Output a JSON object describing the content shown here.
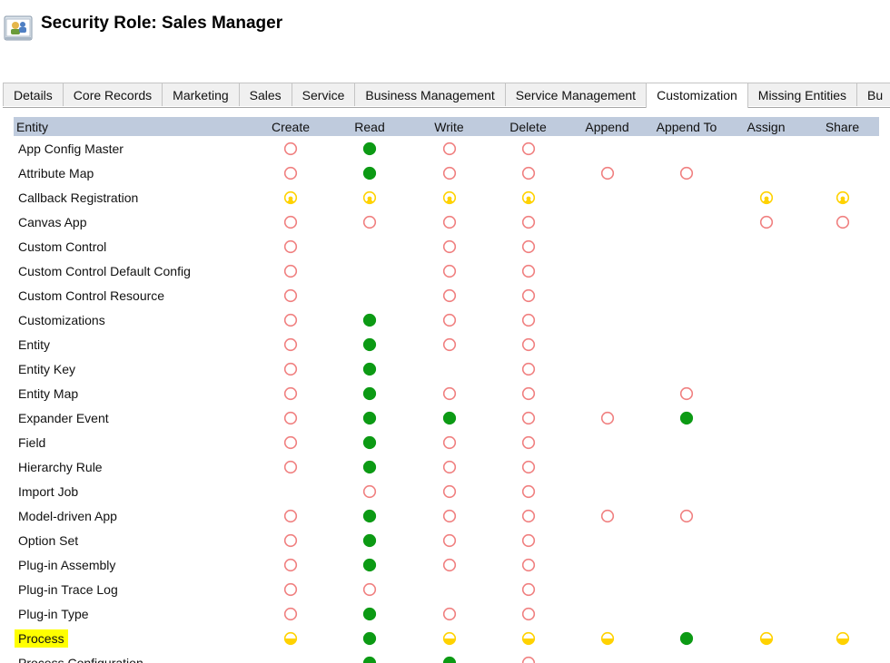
{
  "header": {
    "title": "Security Role: Sales Manager",
    "icon": "security-role-icon"
  },
  "tabs": [
    {
      "label": "Details",
      "active": false
    },
    {
      "label": "Core Records",
      "active": false
    },
    {
      "label": "Marketing",
      "active": false
    },
    {
      "label": "Sales",
      "active": false
    },
    {
      "label": "Service",
      "active": false
    },
    {
      "label": "Business Management",
      "active": false
    },
    {
      "label": "Service Management",
      "active": false
    },
    {
      "label": "Customization",
      "active": true
    },
    {
      "label": "Missing Entities",
      "active": false
    },
    {
      "label": "Bu",
      "active": false
    }
  ],
  "columns": [
    "Entity",
    "Create",
    "Read",
    "Write",
    "Delete",
    "Append",
    "Append To",
    "Assign",
    "Share"
  ],
  "legend": {
    "none": "empty-red-circle",
    "user": "quarter-yellow-circle",
    "bu": "half-yellow-circle",
    "org": "full-green-circle"
  },
  "colors": {
    "header_bg": "#bfcbdd",
    "none": "#f08080",
    "partial": "#ffd200",
    "org": "#0c9a14",
    "highlight": "#ffff00"
  },
  "rows": [
    {
      "entity": "App Config Master",
      "p": [
        "none",
        "org",
        "none",
        "none",
        "",
        "",
        "",
        ""
      ]
    },
    {
      "entity": "Attribute Map",
      "p": [
        "none",
        "org",
        "none",
        "none",
        "none",
        "none",
        "",
        ""
      ]
    },
    {
      "entity": "Callback Registration",
      "p": [
        "user",
        "user",
        "user",
        "user",
        "",
        "",
        "user",
        "user"
      ]
    },
    {
      "entity": "Canvas App",
      "p": [
        "none",
        "none",
        "none",
        "none",
        "",
        "",
        "none",
        "none"
      ]
    },
    {
      "entity": "Custom Control",
      "p": [
        "none",
        "",
        "none",
        "none",
        "",
        "",
        "",
        ""
      ]
    },
    {
      "entity": "Custom Control Default Config",
      "p": [
        "none",
        "",
        "none",
        "none",
        "",
        "",
        "",
        ""
      ]
    },
    {
      "entity": "Custom Control Resource",
      "p": [
        "none",
        "",
        "none",
        "none",
        "",
        "",
        "",
        ""
      ]
    },
    {
      "entity": "Customizations",
      "p": [
        "none",
        "org",
        "none",
        "none",
        "",
        "",
        "",
        ""
      ]
    },
    {
      "entity": "Entity",
      "p": [
        "none",
        "org",
        "none",
        "none",
        "",
        "",
        "",
        ""
      ]
    },
    {
      "entity": "Entity Key",
      "p": [
        "none",
        "org",
        "",
        "none",
        "",
        "",
        "",
        ""
      ]
    },
    {
      "entity": "Entity Map",
      "p": [
        "none",
        "org",
        "none",
        "none",
        "",
        "none",
        "",
        ""
      ]
    },
    {
      "entity": "Expander Event",
      "p": [
        "none",
        "org",
        "org",
        "none",
        "none",
        "org",
        "",
        ""
      ]
    },
    {
      "entity": "Field",
      "p": [
        "none",
        "org",
        "none",
        "none",
        "",
        "",
        "",
        ""
      ]
    },
    {
      "entity": "Hierarchy Rule",
      "p": [
        "none",
        "org",
        "none",
        "none",
        "",
        "",
        "",
        ""
      ]
    },
    {
      "entity": "Import Job",
      "p": [
        "",
        "none",
        "none",
        "none",
        "",
        "",
        "",
        ""
      ]
    },
    {
      "entity": "Model-driven App",
      "p": [
        "none",
        "org",
        "none",
        "none",
        "none",
        "none",
        "",
        ""
      ]
    },
    {
      "entity": "Option Set",
      "p": [
        "none",
        "org",
        "none",
        "none",
        "",
        "",
        "",
        ""
      ]
    },
    {
      "entity": "Plug-in Assembly",
      "p": [
        "none",
        "org",
        "none",
        "none",
        "",
        "",
        "",
        ""
      ]
    },
    {
      "entity": "Plug-in Trace Log",
      "p": [
        "none",
        "none",
        "",
        "none",
        "",
        "",
        "",
        ""
      ]
    },
    {
      "entity": "Plug-in Type",
      "p": [
        "none",
        "org",
        "none",
        "none",
        "",
        "",
        "",
        ""
      ]
    },
    {
      "entity": "Process",
      "highlight": true,
      "p": [
        "bu",
        "org",
        "bu",
        "bu",
        "bu",
        "org",
        "bu",
        "bu"
      ]
    },
    {
      "entity": "Process Configuration",
      "p": [
        "",
        "org",
        "org",
        "none",
        "",
        "",
        "",
        ""
      ]
    }
  ]
}
